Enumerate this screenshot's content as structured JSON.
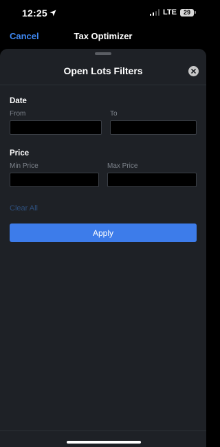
{
  "status_bar": {
    "time": "12:25",
    "network": "LTE",
    "battery": "29",
    "icons": [
      "location-arrow-icon",
      "signal-icon",
      "battery-icon"
    ]
  },
  "nav": {
    "cancel_label": "Cancel",
    "title": "Tax Optimizer"
  },
  "sheet": {
    "title": "Open Lots Filters",
    "close_icon": "close-icon",
    "date": {
      "section_label": "Date",
      "from_label": "From",
      "from_value": "",
      "to_label": "To",
      "to_value": ""
    },
    "price": {
      "section_label": "Price",
      "min_label": "Min Price",
      "min_value": "",
      "max_label": "Max Price",
      "max_value": ""
    },
    "clear_all_label": "Clear All",
    "apply_label": "Apply"
  },
  "colors": {
    "accent": "#3d7cea",
    "link": "#3e87f1",
    "sheet_bg": "#1e2126",
    "disabled_link": "#2e4f7c"
  }
}
